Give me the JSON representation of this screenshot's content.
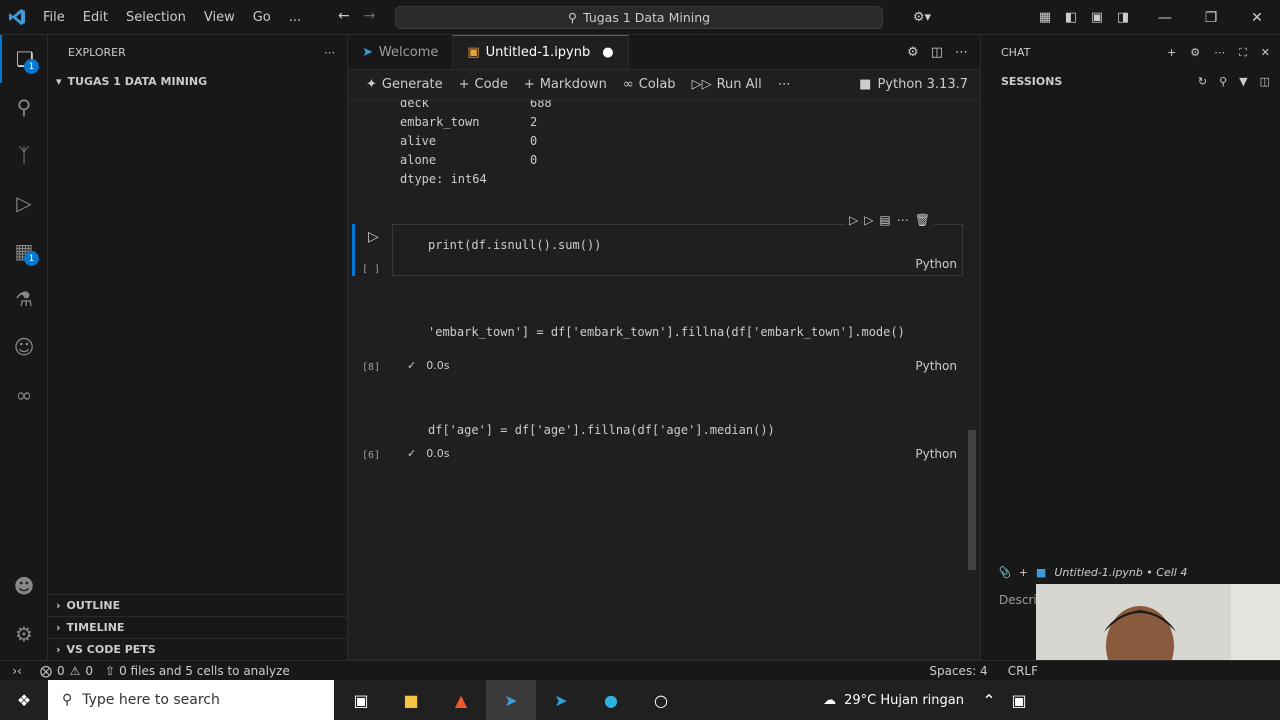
{
  "titlebar": {
    "menus": [
      "File",
      "Edit",
      "Selection",
      "View",
      "Go",
      "..."
    ],
    "title": "Tugas 1 Data Mining"
  },
  "sidebar": {
    "title": "EXPLORER",
    "folder": "TUGAS 1 DATA MINING",
    "bottom_sections": [
      "OUTLINE",
      "TIMELINE",
      "VS CODE PETS"
    ]
  },
  "activitybar": {
    "explorer_badge": "1",
    "extensions_badge": "1"
  },
  "editor": {
    "tabs": [
      {
        "label": "Welcome"
      },
      {
        "label": "Untitled-1.ipynb"
      }
    ],
    "toolbar": {
      "generate": "Generate",
      "code": "Code",
      "markdown": "Markdown",
      "colab": "Colab",
      "run_all": "Run All",
      "kernel": "Python 3.13.7"
    },
    "output_lines": [
      {
        "key": "deck",
        "value": "688"
      },
      {
        "key": "embark_town",
        "value": "2"
      },
      {
        "key": "alive",
        "value": "0"
      },
      {
        "key": "alone",
        "value": "0"
      }
    ],
    "dtype_line": "dtype: int64",
    "cells": [
      {
        "code": "print(df.isnull().sum())",
        "exec": "[ ]",
        "lang": "Python",
        "time": ""
      },
      {
        "code": "'embark_town'] = df['embark_town'].fillna(df['embark_town'].mode()",
        "exec": "[8]",
        "lang": "Python",
        "time": "0.0s"
      },
      {
        "code": "df['age'] = df['age'].fillna(df['age'].median())",
        "exec": "[6]",
        "lang": "Python",
        "time": "0.0s"
      }
    ]
  },
  "chat": {
    "title": "CHAT",
    "sessions": "SESSIONS",
    "attachment": "Untitled-1.ipynb • Cell 4",
    "input_placeholder": "Descri"
  },
  "statusbar": {
    "errors": "0",
    "warnings": "0",
    "analyze": "0 files and 5 cells to analyze",
    "spaces": "Spaces: 4",
    "eol": "CRLF"
  },
  "taskbar": {
    "search_placeholder": "Type here to search",
    "weather": "29°C  Hujan ringan"
  },
  "colors": {
    "accent": "#0078d4",
    "background": "#1f1f1f"
  }
}
